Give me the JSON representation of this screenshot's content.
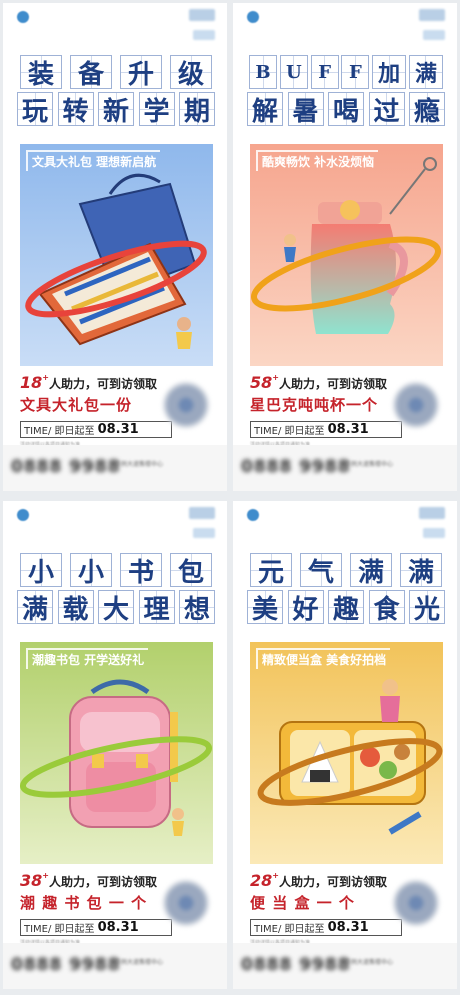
{
  "cards": [
    {
      "title_row1": [
        "装",
        "备",
        "升",
        "级"
      ],
      "title_row2": [
        "玩",
        "转",
        "新",
        "学",
        "期"
      ],
      "tagline": "文具大礼包 理想新启航",
      "helpers_count": "18",
      "offer_text": "人助力，可到访领取",
      "offer_item": "文具大礼包一份",
      "time_label": "TIME/ 即日起至",
      "time_date": "08.31",
      "fineprint": "活动详情以各项目通知为准",
      "hero_colors": [
        "#8fb8ec",
        "#c9ddf6"
      ],
      "ring_color": "#e8433b",
      "footer_phone": "0888 9988",
      "footer_address": "示例大道售楼中心"
    },
    {
      "title_row1": [
        "B",
        "U",
        "F",
        "F",
        "加",
        "满"
      ],
      "title_row2": [
        "解",
        "暑",
        "喝",
        "过",
        "瘾"
      ],
      "tagline": "酷爽畅饮 补水没烦恼",
      "helpers_count": "58",
      "offer_text": "人助力，可到访领取",
      "offer_item": "星巴克吨吨杯一个",
      "time_label": "TIME/ 即日起至",
      "time_date": "08.31",
      "fineprint": "活动详情以各项目通知为准",
      "hero_colors": [
        "#f6a58e",
        "#fbd6c4"
      ],
      "ring_color": "#f0a21a",
      "footer_phone": "0888 9988",
      "footer_address": "示例大道售楼中心"
    },
    {
      "title_row1": [
        "小",
        "小",
        "书",
        "包"
      ],
      "title_row2": [
        "满",
        "载",
        "大",
        "理",
        "想"
      ],
      "tagline": "潮趣书包 开学送好礼",
      "helpers_count": "38",
      "offer_text": "人助力，可到访领取",
      "offer_item": "潮 趣 书 包 一 个",
      "time_label": "TIME/ 即日起至",
      "time_date": "08.31",
      "fineprint": "活动详情以各项目通知为准",
      "hero_colors": [
        "#b2d06c",
        "#e6efc6"
      ],
      "ring_color": "#9acb3a",
      "footer_phone": "0888 9988",
      "footer_address": "示例大道售楼中心"
    },
    {
      "title_row1": [
        "元",
        "气",
        "满",
        "满"
      ],
      "title_row2": [
        "美",
        "好",
        "趣",
        "食",
        "光"
      ],
      "tagline": "精致便当盒 美食好拍档",
      "helpers_count": "28",
      "offer_text": "人助力，可到访领取",
      "offer_item": "便 当 盒 一 个",
      "time_label": "TIME/ 即日起至",
      "time_date": "08.31",
      "fineprint": "活动详情以各项目通知为准",
      "hero_colors": [
        "#f2c35a",
        "#fbe9b7"
      ],
      "ring_color": "#c77a1e",
      "footer_phone": "0888 9988",
      "footer_address": "示例大道售楼中心"
    }
  ]
}
